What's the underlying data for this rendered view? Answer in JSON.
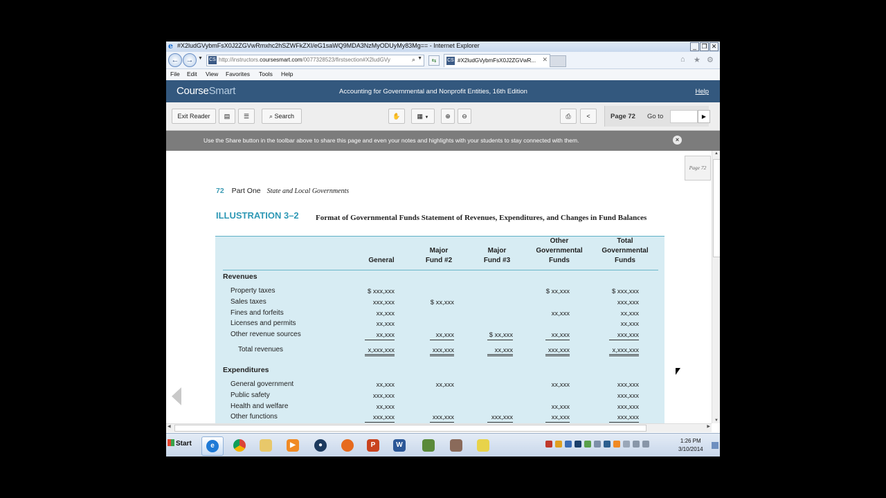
{
  "window": {
    "title": "#X2ludGVybmFsX0J2ZGVwRmxhc2hSZWFkZXI/eG1saWQ9MDA3NzMyODUyMy83Mg== - Internet Explorer"
  },
  "navbar": {
    "url_prefix": "http://instructors.",
    "url_domain": "coursesmart.com",
    "url_suffix": "/0077328523/firstsection#X2ludGVy",
    "tab_label": "#X2ludGVybmFsX0J2ZGVwR..."
  },
  "menu": [
    "File",
    "Edit",
    "View",
    "Favorites",
    "Tools",
    "Help"
  ],
  "header": {
    "logo_course": "Course",
    "logo_smart": "Smart",
    "book_title": "Accounting for Governmental and Nonprofit Entities, 16th Edition",
    "help": "Help"
  },
  "toolbar": {
    "exit_reader": "Exit Reader",
    "search": "Search",
    "page_label": "Page 72",
    "goto_label": "Go to"
  },
  "notice": {
    "message": "Use the Share button in the toolbar above to share this page and even your notes and highlights with your students to stay connected with them."
  },
  "page": {
    "badge": "Page 72",
    "number": "72",
    "part": "Part One",
    "part_subtitle": "State and Local Governments",
    "illustration_id": "ILLUSTRATION 3–2",
    "illustration_title": "Format of Governmental Funds Statement of Revenues, Expenditures, and Changes in Fund Balances"
  },
  "table": {
    "headers": [
      [
        "General"
      ],
      [
        "Major",
        "Fund #2"
      ],
      [
        "Major",
        "Fund #3"
      ],
      [
        "Other",
        "Governmental",
        "Funds"
      ],
      [
        "Total",
        "Governmental",
        "Funds"
      ]
    ],
    "revenues_title": "Revenues",
    "revenues": [
      {
        "label": "Property taxes",
        "values": [
          "$ xxx,xxx",
          "",
          "",
          "$ xx,xxx",
          "$ xxx,xxx"
        ]
      },
      {
        "label": "Sales taxes",
        "values": [
          "xxx,xxx",
          "$ xx,xxx",
          "",
          "",
          "xxx,xxx"
        ]
      },
      {
        "label": "Fines and forfeits",
        "values": [
          "xx,xxx",
          "",
          "",
          "xx,xxx",
          "xx,xxx"
        ]
      },
      {
        "label": "Licenses and permits",
        "values": [
          "xx,xxx",
          "",
          "",
          "",
          "xx,xxx"
        ]
      },
      {
        "label": "Other revenue sources",
        "values": [
          "xx,xxx",
          "xx,xxx",
          "$ xx,xxx",
          "xx,xxx",
          "xxx,xxx"
        ]
      }
    ],
    "total_revenues": {
      "label": "Total revenues",
      "values": [
        "x,xxx,xxx",
        "xxx,xxx",
        "xx,xxx",
        "xxx,xxx",
        "x,xxx,xxx"
      ]
    },
    "expenditures_title": "Expenditures",
    "expenditures": [
      {
        "label": "General government",
        "values": [
          "xx,xxx",
          "xx,xxx",
          "",
          "xx,xxx",
          "xxx,xxx"
        ]
      },
      {
        "label": "Public safety",
        "values": [
          "xxx,xxx",
          "",
          "",
          "",
          "xxx,xxx"
        ]
      },
      {
        "label": "Health and welfare",
        "values": [
          "xx,xxx",
          "",
          "",
          "xx,xxx",
          "xxx,xxx"
        ]
      },
      {
        "label": "Other functions",
        "values": [
          "xxx,xxx",
          "xxx,xxx",
          "xxx,xxx",
          "xx,xxx",
          "xxx,xxx"
        ]
      }
    ]
  },
  "taskbar": {
    "start": "Start",
    "time": "1:26 PM",
    "date": "3/10/2014"
  }
}
